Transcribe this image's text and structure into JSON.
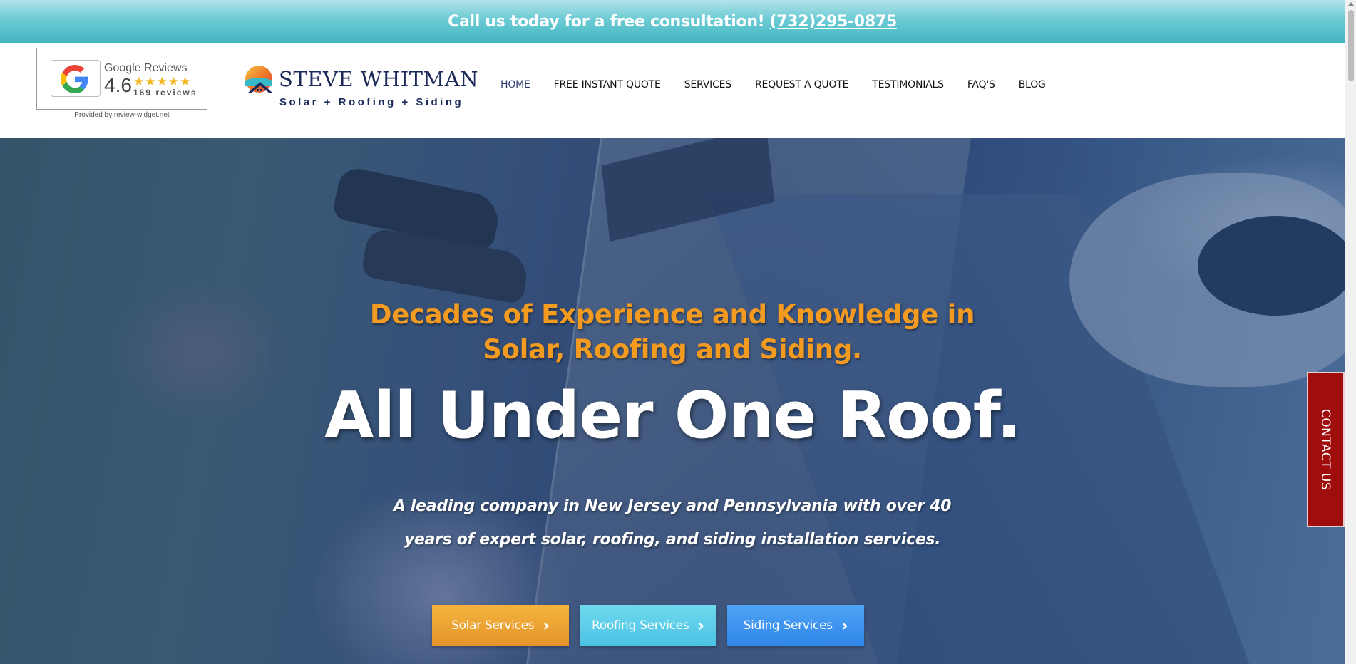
{
  "topbar": {
    "text": "Call us today for a free consultation!",
    "phone": "(732)295-0875"
  },
  "review_widget": {
    "title": "Google Reviews",
    "score": "4.6",
    "stars": "★★★★★",
    "count": "169 reviews",
    "provided_by": "Provided by review-widget.net"
  },
  "brand": {
    "name": "STEVE WHITMAN",
    "tagline": "Solar + Roofing + Siding"
  },
  "nav": {
    "items": [
      {
        "label": "HOME",
        "active": true
      },
      {
        "label": "FREE INSTANT QUOTE"
      },
      {
        "label": "SERVICES"
      },
      {
        "label": "REQUEST A QUOTE"
      },
      {
        "label": "TESTIMONIALS"
      },
      {
        "label": "FAQ'S"
      },
      {
        "label": "BLOG"
      }
    ]
  },
  "hero": {
    "subtitle_line1": "Decades of Experience and Knowledge in",
    "subtitle_line2": "Solar, Roofing and Siding.",
    "title": "All Under One Roof.",
    "desc_line1": "A leading company in New Jersey and Pennsylvania with over 40",
    "desc_line2": "years of expert solar, roofing, and siding installation services."
  },
  "buttons": {
    "solar": "Solar Services",
    "roofing": "Roofing Services",
    "siding": "Siding Services",
    "chevron": "›"
  },
  "contact_tab": "CONTACT US",
  "colors": {
    "topbar": "#44b6c2",
    "brand_navy": "#1b2a5a",
    "accent_orange": "#f39a21",
    "contact_red": "#a00d0d"
  }
}
